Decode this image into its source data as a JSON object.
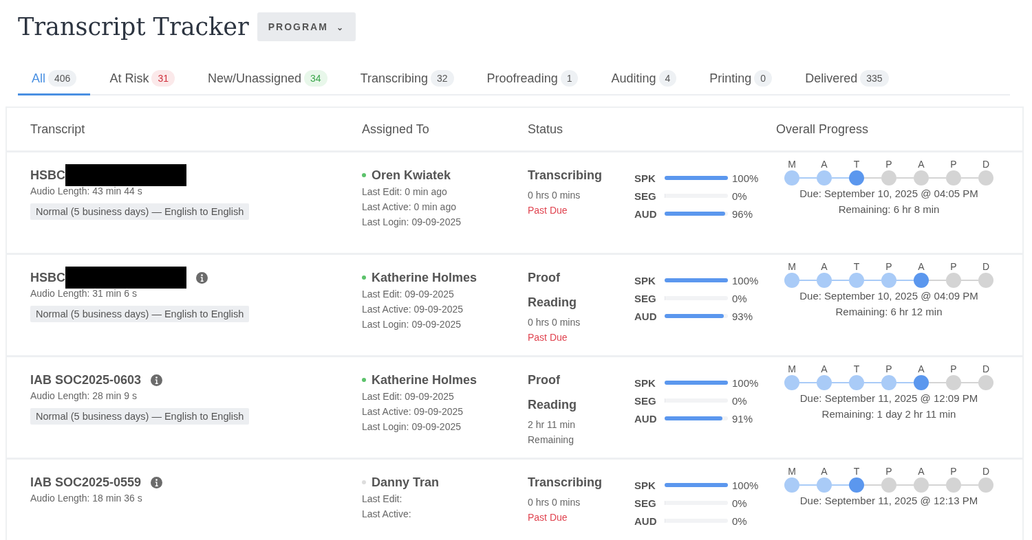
{
  "title": "Transcript Tracker",
  "program_button": {
    "label": "PROGRAM",
    "caret": "⌄"
  },
  "tabs": [
    {
      "label": "All",
      "count": "406",
      "kind": "neutral",
      "selected": true
    },
    {
      "label": "At Risk",
      "count": "31",
      "kind": "danger",
      "selected": false
    },
    {
      "label": "New/Unassigned",
      "count": "34",
      "kind": "success",
      "selected": false
    },
    {
      "label": "Transcribing",
      "count": "32",
      "kind": "neutral",
      "selected": false
    },
    {
      "label": "Proofreading",
      "count": "1",
      "kind": "neutral",
      "selected": false
    },
    {
      "label": "Auditing",
      "count": "4",
      "kind": "neutral",
      "selected": false
    },
    {
      "label": "Printing",
      "count": "0",
      "kind": "neutral",
      "selected": false
    },
    {
      "label": "Delivered",
      "count": "335",
      "kind": "neutral",
      "selected": false
    }
  ],
  "table": {
    "columns": [
      "Transcript",
      "Assigned To",
      "Status",
      "Overall Progress"
    ],
    "rows": [
      {
        "name": "HSBC",
        "redacted": true,
        "info": false,
        "audio": "Audio Length: 43 min 44 s",
        "tag": "Normal (5 business days) — English to English",
        "assignee": "Oren Kwiatek",
        "online": true,
        "activity": [
          "Last Edit: 0 min ago",
          "Last Active: 0 min ago",
          "Last Login: 09-09-2025"
        ],
        "status": "Transcribing",
        "time": [
          "0 hrs 0 mins"
        ],
        "note": "Past Due",
        "overdue": true,
        "metrics": [
          {
            "label": "SPK",
            "level": 1,
            "reading": "100%"
          },
          {
            "label": "SEG",
            "level": 0,
            "reading": "0%"
          },
          {
            "label": "AUD",
            "level": 0.96,
            "reading": "96%"
          }
        ],
        "stages": [
          {
            "label": "M",
            "kind": "done"
          },
          {
            "label": "A",
            "kind": "done"
          },
          {
            "label": "T",
            "kind": "current"
          },
          {
            "label": "P",
            "kind": "pending"
          },
          {
            "label": "A",
            "kind": "pending"
          },
          {
            "label": "P",
            "kind": "pending"
          },
          {
            "label": "D",
            "kind": "pending"
          }
        ],
        "due": "Due: September 10, 2025 @ 04:05 PM",
        "remaining": "Remaining: 6 hr 8 min"
      },
      {
        "name": "HSBC",
        "redacted": true,
        "info": true,
        "audio": "Audio Length: 31 min 6 s",
        "tag": "Normal (5 business days) — English to English",
        "assignee": "Katherine Holmes",
        "online": true,
        "activity": [
          "Last Edit: 09-09-2025",
          "Last Active: 09-09-2025",
          "Last Login: 09-09-2025"
        ],
        "status": "Proof Reading",
        "time": [
          "0 hrs 0 mins"
        ],
        "note": "Past Due",
        "overdue": true,
        "metrics": [
          {
            "label": "SPK",
            "level": 1,
            "reading": "100%"
          },
          {
            "label": "SEG",
            "level": 0,
            "reading": "0%"
          },
          {
            "label": "AUD",
            "level": 0.93,
            "reading": "93%"
          }
        ],
        "stages": [
          {
            "label": "M",
            "kind": "done"
          },
          {
            "label": "A",
            "kind": "done"
          },
          {
            "label": "T",
            "kind": "done"
          },
          {
            "label": "P",
            "kind": "done"
          },
          {
            "label": "A",
            "kind": "current"
          },
          {
            "label": "P",
            "kind": "pending"
          },
          {
            "label": "D",
            "kind": "pending"
          }
        ],
        "due": "Due: September 10, 2025 @ 04:09 PM",
        "remaining": "Remaining: 6 hr 12 min"
      },
      {
        "name": "IAB SOC2025-0603",
        "redacted": false,
        "info": true,
        "audio": "Audio Length: 28 min 9 s",
        "tag": "Normal (5 business days) — English to English",
        "assignee": "Katherine Holmes",
        "online": true,
        "activity": [
          "Last Edit: 09-09-2025",
          "Last Active: 09-09-2025",
          "Last Login: 09-09-2025"
        ],
        "status": "Proof Reading",
        "time": [
          "2 hr 11 min",
          "Remaining"
        ],
        "overdue": false,
        "metrics": [
          {
            "label": "SPK",
            "level": 1,
            "reading": "100%"
          },
          {
            "label": "SEG",
            "level": 0,
            "reading": "0%"
          },
          {
            "label": "AUD",
            "level": 0.91,
            "reading": "91%"
          }
        ],
        "stages": [
          {
            "label": "M",
            "kind": "done"
          },
          {
            "label": "A",
            "kind": "done"
          },
          {
            "label": "T",
            "kind": "done"
          },
          {
            "label": "P",
            "kind": "done"
          },
          {
            "label": "A",
            "kind": "current"
          },
          {
            "label": "P",
            "kind": "pending"
          },
          {
            "label": "D",
            "kind": "pending"
          }
        ],
        "due": "Due: September 11, 2025 @ 12:09 PM",
        "remaining": "Remaining: 1 day 2 hr 11 min"
      },
      {
        "name": "IAB SOC2025-0559",
        "redacted": false,
        "info": true,
        "audio": "Audio Length: 18 min 36 s",
        "assignee": "Danny Tran",
        "online": false,
        "activity": [
          "Last Edit:",
          "Last Active:"
        ],
        "status": "Transcribing",
        "time": [
          "0 hrs 0 mins"
        ],
        "note": "Past Due",
        "overdue": true,
        "metrics": [
          {
            "label": "SPK",
            "level": 1,
            "reading": "100%"
          },
          {
            "label": "SEG",
            "level": 0,
            "reading": "0%"
          },
          {
            "label": "AUD",
            "level": 0,
            "reading": "0%"
          }
        ],
        "stages": [
          {
            "label": "M",
            "kind": "done"
          },
          {
            "label": "A",
            "kind": "done"
          },
          {
            "label": "T",
            "kind": "current"
          },
          {
            "label": "P",
            "kind": "pending"
          },
          {
            "label": "A",
            "kind": "pending"
          },
          {
            "label": "P",
            "kind": "pending"
          },
          {
            "label": "D",
            "kind": "pending"
          }
        ],
        "due": "Due: September 11, 2025 @ 12:13 PM"
      }
    ]
  }
}
